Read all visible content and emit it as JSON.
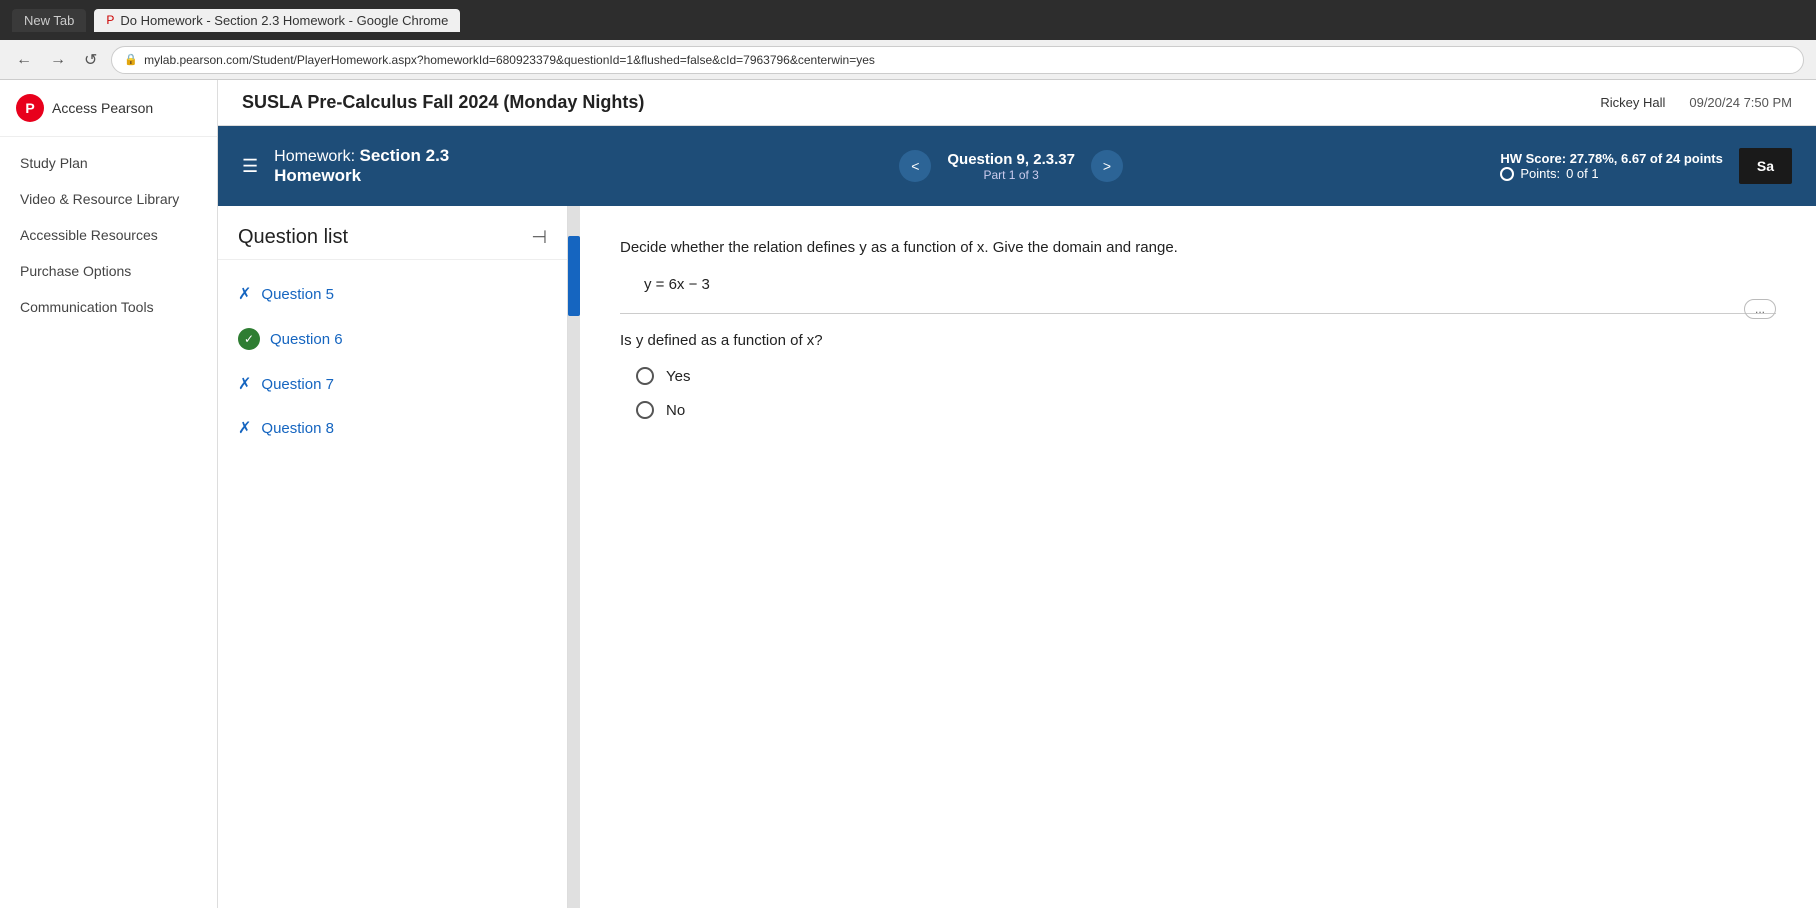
{
  "browser": {
    "tab_inactive": "New Tab",
    "tab_active_icon": "P",
    "tab_active_label": "Do Homework - Section 2.3 Homework - Google Chrome",
    "address_icon": "⟳",
    "address_url": "mylab.pearson.com/Student/PlayerHomework.aspx?homeworkId=680923379&questionId=1&flushed=false&cId=7963796&centerwin=yes",
    "access_pearson": "Access Pearson",
    "mylab_short": "mylab"
  },
  "sidebar": {
    "logo_letter": "P",
    "logo_text": "Access Pearson",
    "items": [
      {
        "label": "Study Plan"
      },
      {
        "label": "Video & Resource Library"
      },
      {
        "label": "Accessible Resources"
      },
      {
        "label": "Purchase Options"
      },
      {
        "label": "Communication Tools"
      }
    ]
  },
  "top_bar": {
    "course_title": "SUSLA Pre-Calculus Fall 2024 (Monday Nights)",
    "user_name": "Rickey Hall",
    "date_time": "09/20/24 7:50 PM"
  },
  "hw_header": {
    "homework_label": "Homework:",
    "homework_name": "Section 2.3",
    "homework_sub": "Homework",
    "question_label": "Question 9, 2.3.37",
    "part_label": "Part 1 of 3",
    "prev_label": "<",
    "next_label": ">",
    "hw_score_label": "HW Score:",
    "hw_score_value": "27.78%, 6.67 of 24 points",
    "points_label": "Points:",
    "points_value": "0 of 1",
    "save_label": "Sa"
  },
  "question_list": {
    "title": "Question list",
    "collapse_icon": "⊣",
    "items": [
      {
        "id": "q5",
        "label": "Question 5",
        "status": "x"
      },
      {
        "id": "q6",
        "label": "Question 6",
        "status": "check"
      },
      {
        "id": "q7",
        "label": "Question 7",
        "status": "x"
      },
      {
        "id": "q8",
        "label": "Question 8",
        "status": "x"
      }
    ]
  },
  "question": {
    "instruction": "Decide whether the relation defines y as a function of x. Give the domain and range.",
    "equation": "y = 6x − 3",
    "expand_label": "...",
    "sub_question": "Is y defined as a function of x?",
    "options": [
      {
        "label": "Yes"
      },
      {
        "label": "No"
      }
    ]
  }
}
